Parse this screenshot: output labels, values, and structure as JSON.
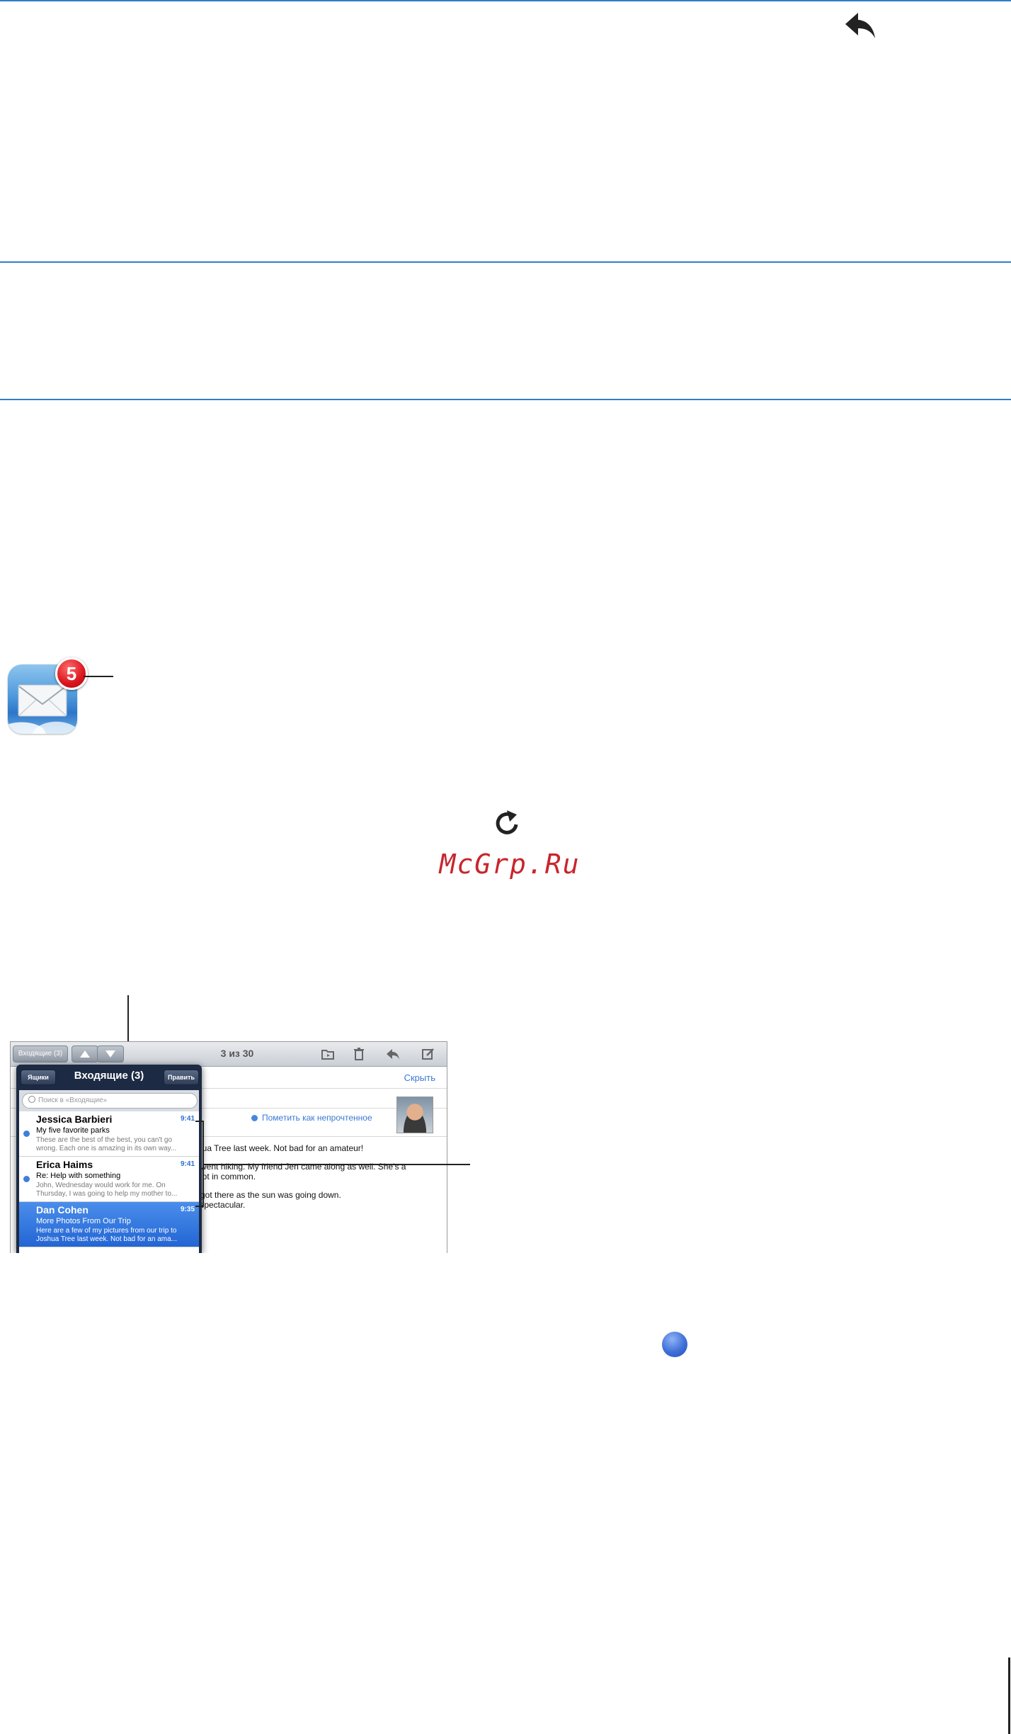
{
  "icons": {
    "reply": "reply-arrow-icon",
    "refresh": "refresh-icon",
    "mail_app": "mail-app-icon",
    "unread": "unread-dot-icon"
  },
  "mail_badge": "5",
  "watermark": "McGrp.Ru",
  "screenshot": {
    "toolbar": {
      "inbox_button": "Входящие (3)",
      "counter": "3 из 30"
    },
    "hide_link": "Скрыть",
    "mark_unread": "Пометить как непрочтенное",
    "body_lines": [
      "shua Tree last week. Not bad for an amateur!",
      "e went hiking. My friend Jen came along as well. She's a",
      "a lot in common.",
      "e got there as the sun was going down.",
      "s spectacular."
    ],
    "popover": {
      "mailboxes_button": "Ящики",
      "title": "Входящие (3)",
      "edit_button": "Править",
      "search_placeholder": "Поиск в «Входящие»",
      "messages": [
        {
          "from": "Jessica Barbieri",
          "time": "9:41",
          "subject": "My five favorite parks",
          "preview": "These are the best of the best, you can't go wrong. Each one is amazing in its own way..."
        },
        {
          "from": "Erica Haims",
          "time": "9:41",
          "subject": "Re: Help with something",
          "preview": "John, Wednesday would work for me. On Thursday, I was going to help my mother to..."
        },
        {
          "from": "Dan Cohen",
          "time": "9:35",
          "subject": "More Photos From Our Trip",
          "preview": "Here are a few of my pictures from our trip to Joshua Tree last week. Not bad for an ama..."
        }
      ]
    }
  },
  "colors": {
    "rule": "#2f7ec6",
    "watermark": "#c8262c",
    "link": "#3a78d4",
    "unread_dot": "#3f7fdc"
  }
}
